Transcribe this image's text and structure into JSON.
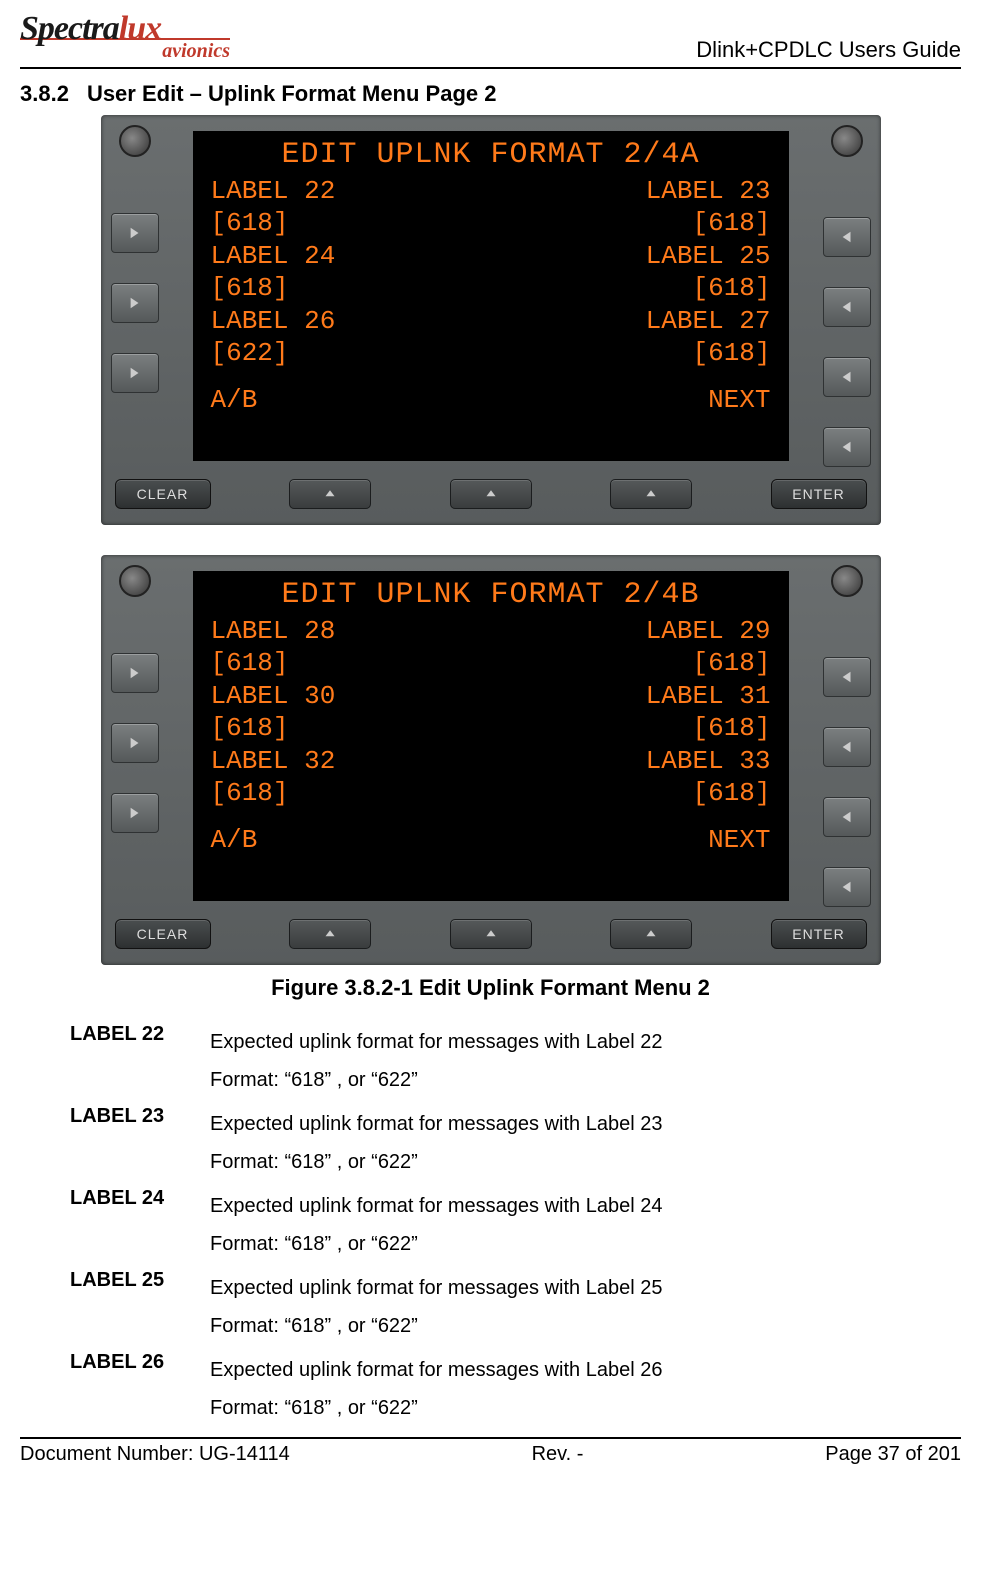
{
  "header": {
    "logo_a": "Spectra",
    "logo_b": "lux",
    "logo_sub": "avionics",
    "doc_title": "Dlink+CPDLC Users Guide"
  },
  "section": {
    "number": "3.8.2",
    "title": "User Edit – Uplink Format Menu Page 2"
  },
  "screens": [
    {
      "title": "EDIT UPLNK FORMAT 2/4A",
      "rows": [
        {
          "l": "LABEL 22",
          "r": "LABEL 23"
        },
        {
          "l": "[618]",
          "r": "[618]"
        },
        {
          "l": "LABEL 24",
          "r": "LABEL 25"
        },
        {
          "l": "[618]",
          "r": "[618]"
        },
        {
          "l": "LABEL 26",
          "r": "LABEL 27"
        },
        {
          "l": "[622]",
          "r": "[618]"
        }
      ],
      "foot_l": "A/B",
      "foot_r": "NEXT"
    },
    {
      "title": "EDIT UPLNK FORMAT 2/4B",
      "rows": [
        {
          "l": "LABEL 28",
          "r": "LABEL 29"
        },
        {
          "l": "[618]",
          "r": "[618]"
        },
        {
          "l": "LABEL 30",
          "r": "LABEL 31"
        },
        {
          "l": "[618]",
          "r": "[618]"
        },
        {
          "l": "LABEL 32",
          "r": "LABEL 33"
        },
        {
          "l": "[618]",
          "r": "[618]"
        }
      ],
      "foot_l": "A/B",
      "foot_r": "NEXT"
    }
  ],
  "bezel": {
    "clear": "CLEAR",
    "enter": "ENTER"
  },
  "caption": "Figure 3.8.2-1 Edit Uplink Formant Menu 2",
  "definitions": [
    {
      "term": "LABEL 22",
      "l1": "Expected uplink format for messages with Label 22",
      "l2": "Format: “618” , or “622”"
    },
    {
      "term": "LABEL 23",
      "l1": "Expected uplink format for messages with Label 23",
      "l2": "Format: “618” , or “622”"
    },
    {
      "term": "LABEL 24",
      "l1": "Expected uplink format for messages with Label 24",
      "l2": "Format: “618” , or “622”"
    },
    {
      "term": "LABEL 25",
      "l1": "Expected uplink format for messages with Label 25",
      "l2": "Format: “618” , or “622”"
    },
    {
      "term": "LABEL 26",
      "l1": "Expected uplink format for messages with Label 26",
      "l2": "Format: “618” , or “622”"
    }
  ],
  "footer": {
    "left": "Document Number:  UG-14114",
    "center": "Rev. -",
    "right": "Page 37 of 201"
  }
}
